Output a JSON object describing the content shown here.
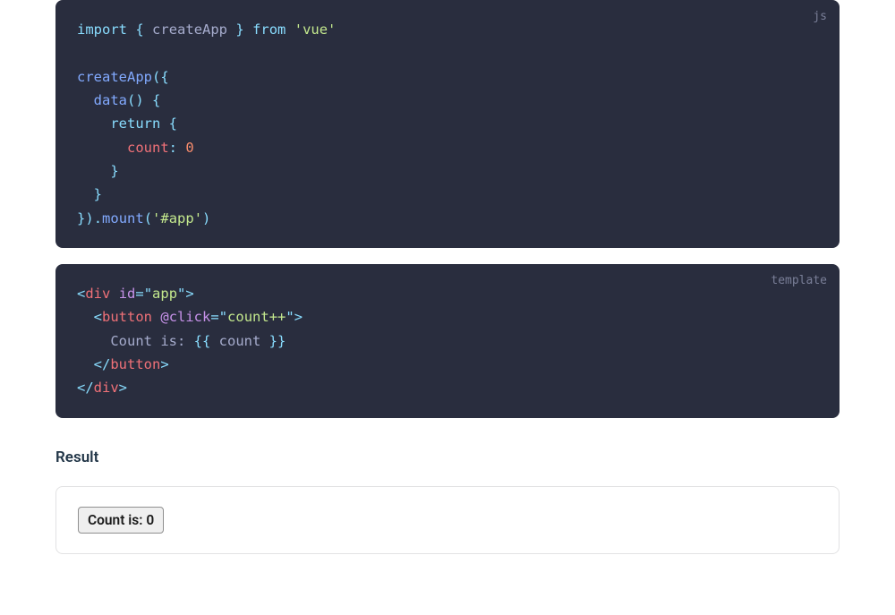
{
  "codeblocks": {
    "js": {
      "lang": "js",
      "t": {
        "import": "import",
        "ob1": "{",
        "createApp": "createApp",
        "cb1": "}",
        "from": "from",
        "vue": "'vue'",
        "createAppCall": "createApp",
        "op1": "(",
        "ob2": "{",
        "data": "data",
        "dp1": "(",
        "dp2": ")",
        "ob3": "{",
        "return": "return",
        "ob4": "{",
        "count": "count",
        "colon": ":",
        "zero": "0",
        "cb4": "}",
        "cb3": "}",
        "cb2": "}",
        "cp1": ")",
        "dot": ".",
        "mount": "mount",
        "mp1": "(",
        "appStr": "'#app'",
        "mp2": ")"
      }
    },
    "template": {
      "lang": "template",
      "t": {
        "lt1": "<",
        "div": "div",
        "id": "id",
        "eq": "=",
        "q": "\"",
        "app": "app",
        "gt1": ">",
        "lt2": "<",
        "button": "button",
        "click": "@click",
        "countpp": "count++",
        "gt2": ">",
        "countis": "Count is: ",
        "dbl1": "{{",
        "countvar": " count ",
        "dbl2": "}}",
        "lt3": "</",
        "gt3": ">",
        "lt4": "</",
        "gt4": ">"
      }
    }
  },
  "result": {
    "heading": "Result",
    "button_label": "Count is: 0"
  }
}
